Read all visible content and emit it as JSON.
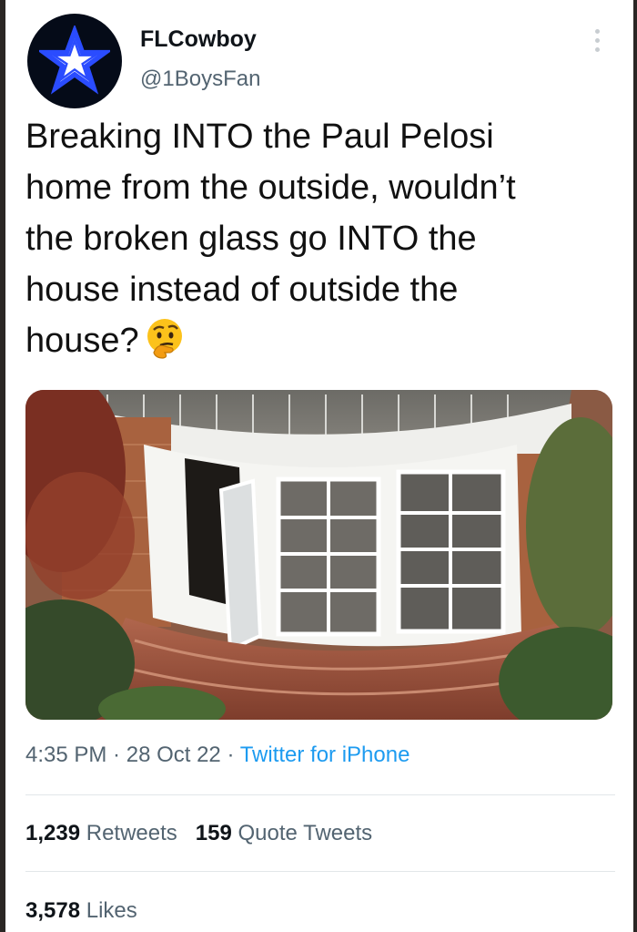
{
  "tweet": {
    "display_name": "FLCowboy",
    "handle": "@1BoysFan",
    "text": "Breaking INTO the Paul Pelosi\nhome from the outside, wouldn’t\nthe broken glass go INTO the\nhouse instead of outside the\nhouse?",
    "emoji_icon": "thinking-face-icon",
    "media_description_icon": "photo",
    "time": "4:35 PM",
    "date": "28 Oct 22",
    "source": "Twitter for iPhone",
    "separator": " · "
  },
  "stats": {
    "retweets_count": "1,239",
    "retweets_label": "Retweets",
    "quotes_count": "159",
    "quotes_label": "Quote Tweets",
    "likes_count": "3,578",
    "likes_label": "Likes"
  },
  "colors": {
    "accent": "#1d9bf0",
    "secondary_text": "#536471",
    "avatar_bg": "#050b18",
    "star": "#2a4cff"
  }
}
